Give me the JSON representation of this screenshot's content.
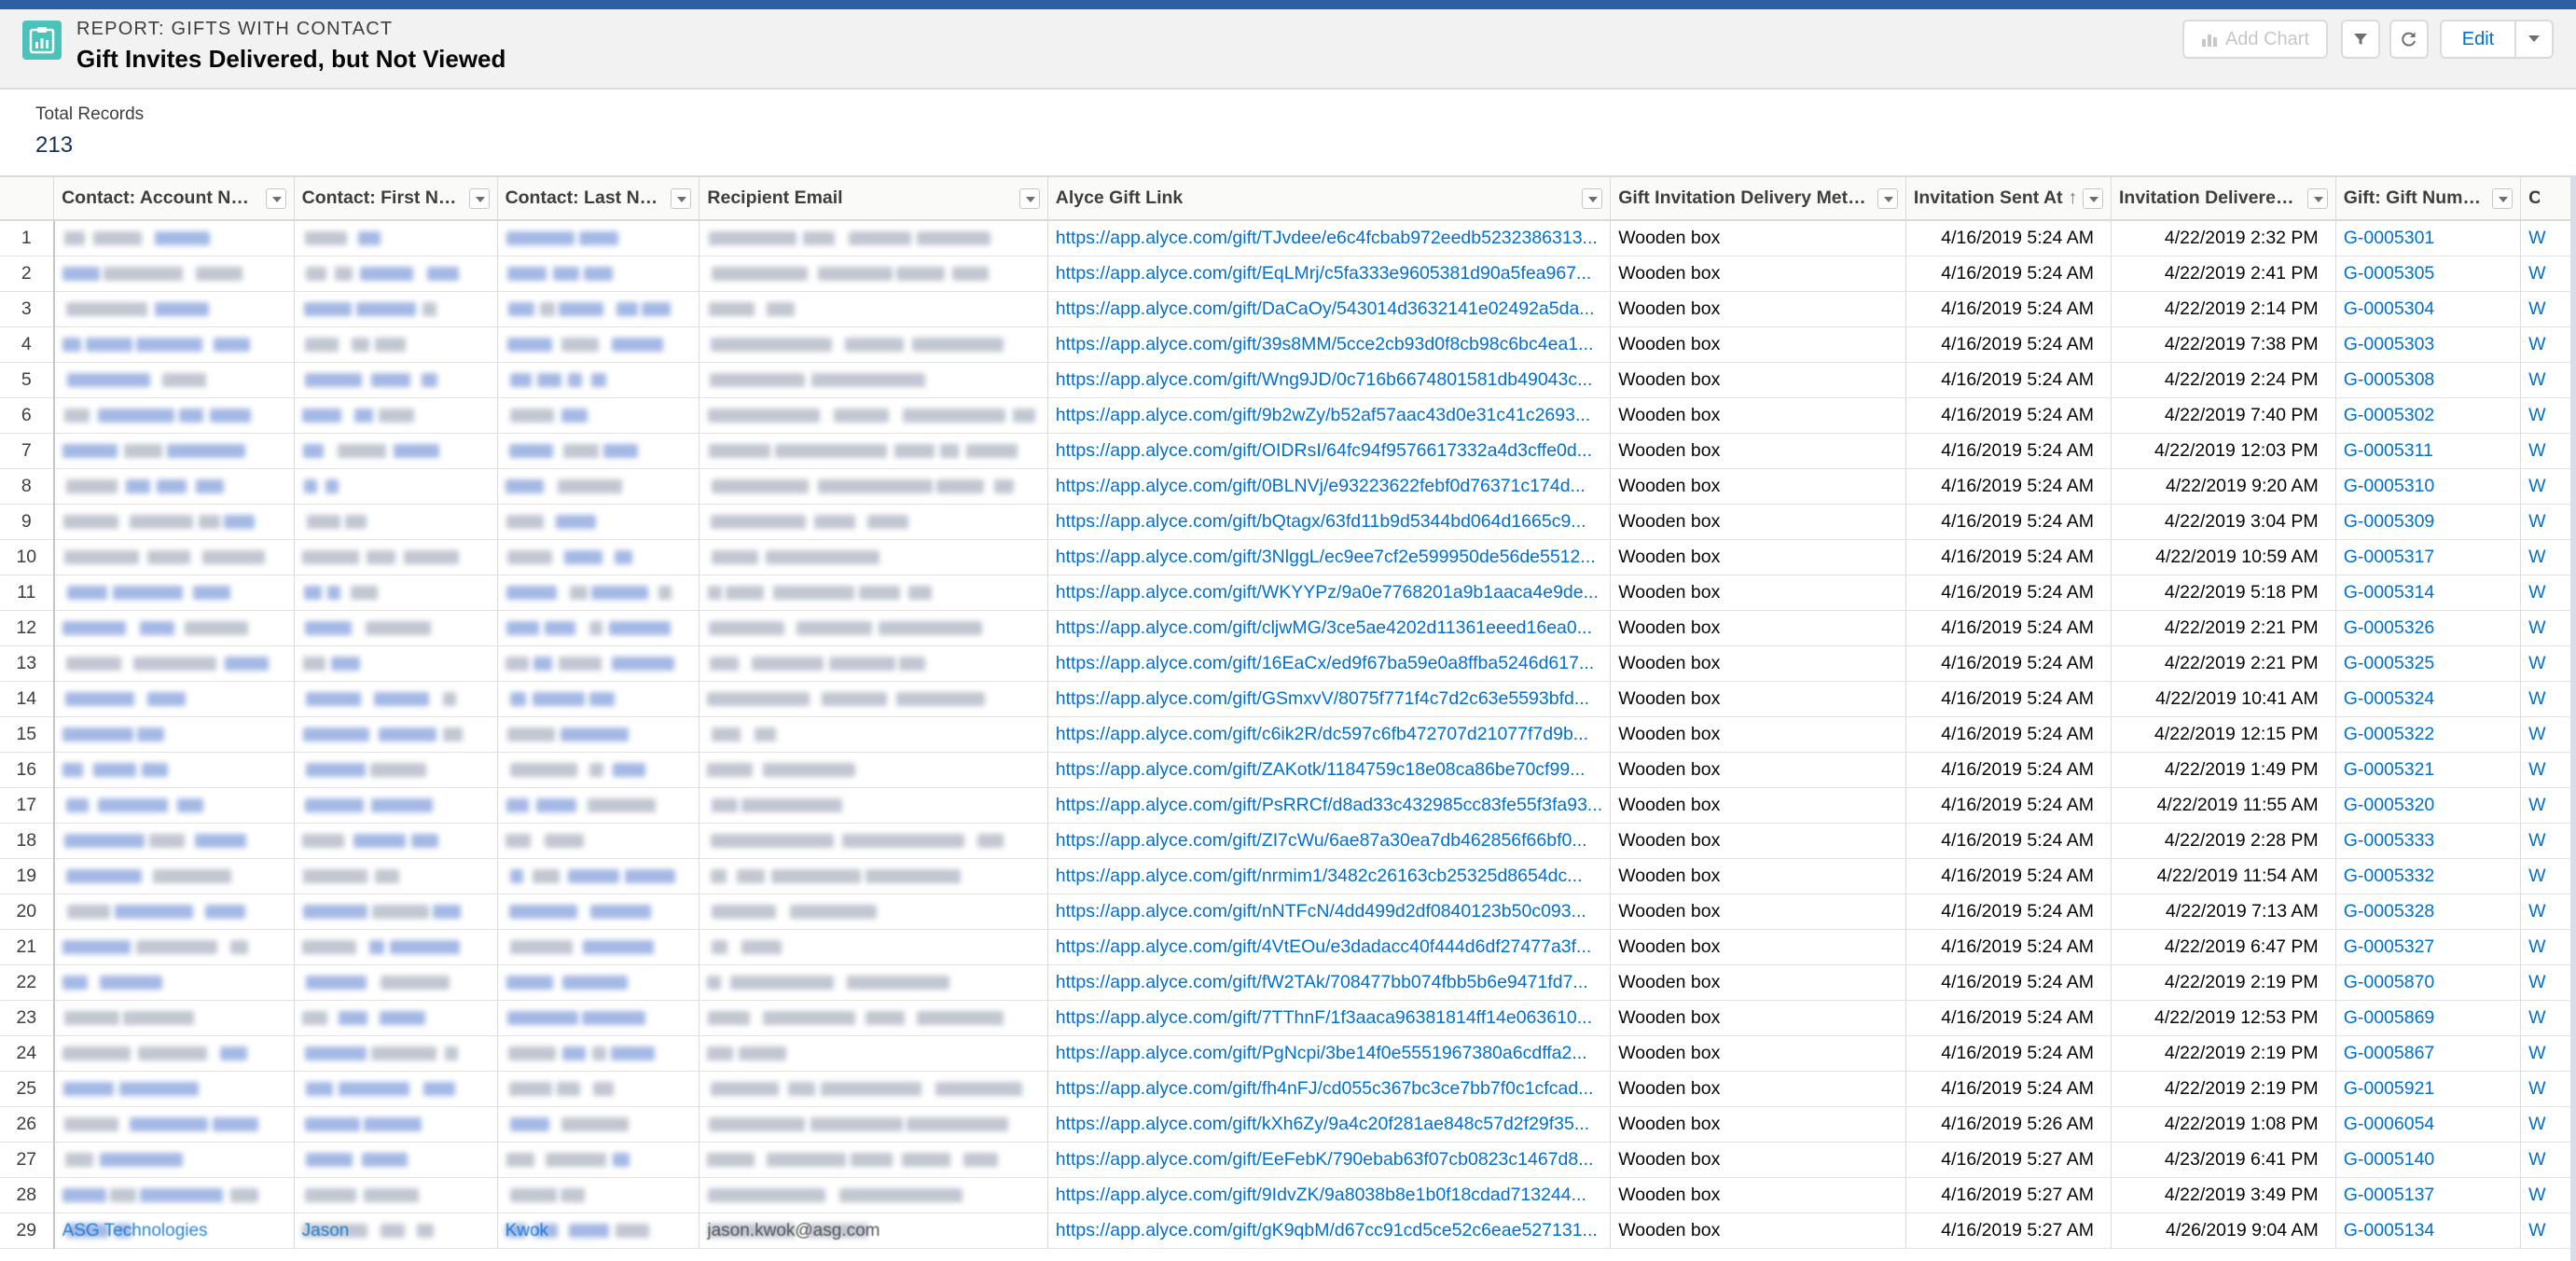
{
  "report": {
    "type_label": "REPORT: GIFTS WITH CONTACT",
    "title": "Gift Invites Delivered, but Not Viewed"
  },
  "toolbar": {
    "add_chart_label": "Add Chart",
    "edit_label": "Edit"
  },
  "summary": {
    "total_label": "Total Records",
    "total_value": "213"
  },
  "columns": [
    {
      "label": "Contact: Account Name"
    },
    {
      "label": "Contact: First Name"
    },
    {
      "label": "Contact: Last Name"
    },
    {
      "label": "Recipient Email"
    },
    {
      "label": "Alyce Gift Link"
    },
    {
      "label": "Gift Invitation Delivery Method"
    },
    {
      "label": "Invitation Sent At",
      "sort": "ascending"
    },
    {
      "label": "Invitation Delivered At"
    },
    {
      "label": "Gift: Gift Number"
    },
    {
      "label": "Ca"
    }
  ],
  "rows": [
    {
      "n": "1",
      "link": "https://app.alyce.com/gift/TJvdee/e6c4fcbab972eedb5232386313...",
      "method": "Wooden box",
      "sent": "4/16/2019 5:24 AM",
      "delivered": "4/22/2019 2:32 PM",
      "gift": "G-0005301",
      "extra": "W"
    },
    {
      "n": "2",
      "link": "https://app.alyce.com/gift/EqLMrj/c5fa333e9605381d90a5fea967...",
      "method": "Wooden box",
      "sent": "4/16/2019 5:24 AM",
      "delivered": "4/22/2019 2:41 PM",
      "gift": "G-0005305",
      "extra": "W"
    },
    {
      "n": "3",
      "link": "https://app.alyce.com/gift/DaCaOy/543014d3632141e02492a5da...",
      "method": "Wooden box",
      "sent": "4/16/2019 5:24 AM",
      "delivered": "4/22/2019 2:14 PM",
      "gift": "G-0005304",
      "extra": "W"
    },
    {
      "n": "4",
      "link": "https://app.alyce.com/gift/39s8MM/5cce2cb93d0f8cb98c6bc4ea1...",
      "method": "Wooden box",
      "sent": "4/16/2019 5:24 AM",
      "delivered": "4/22/2019 7:38 PM",
      "gift": "G-0005303",
      "extra": "W"
    },
    {
      "n": "5",
      "link": "https://app.alyce.com/gift/Wng9JD/0c716b6674801581db49043c...",
      "method": "Wooden box",
      "sent": "4/16/2019 5:24 AM",
      "delivered": "4/22/2019 2:24 PM",
      "gift": "G-0005308",
      "extra": "W"
    },
    {
      "n": "6",
      "link": "https://app.alyce.com/gift/9b2wZy/b52af57aac43d0e31c41c2693...",
      "method": "Wooden box",
      "sent": "4/16/2019 5:24 AM",
      "delivered": "4/22/2019 7:40 PM",
      "gift": "G-0005302",
      "extra": "W"
    },
    {
      "n": "7",
      "link": "https://app.alyce.com/gift/OIDRsI/64fc94f9576617332a4d3cffe0d...",
      "method": "Wooden box",
      "sent": "4/16/2019 5:24 AM",
      "delivered": "4/22/2019 12:03 PM",
      "gift": "G-0005311",
      "extra": "W"
    },
    {
      "n": "8",
      "link": "https://app.alyce.com/gift/0BLNVj/e93223622febf0d76371c174d...",
      "method": "Wooden box",
      "sent": "4/16/2019 5:24 AM",
      "delivered": "4/22/2019 9:20 AM",
      "gift": "G-0005310",
      "extra": "W"
    },
    {
      "n": "9",
      "link": "https://app.alyce.com/gift/bQtagx/63fd11b9d5344bd064d1665c9...",
      "method": "Wooden box",
      "sent": "4/16/2019 5:24 AM",
      "delivered": "4/22/2019 3:04 PM",
      "gift": "G-0005309",
      "extra": "W"
    },
    {
      "n": "10",
      "link": "https://app.alyce.com/gift/3NlggL/ec9ee7cf2e599950de56de5512...",
      "method": "Wooden box",
      "sent": "4/16/2019 5:24 AM",
      "delivered": "4/22/2019 10:59 AM",
      "gift": "G-0005317",
      "extra": "W"
    },
    {
      "n": "11",
      "link": "https://app.alyce.com/gift/WKYYPz/9a0e7768201a9b1aaca4e9de...",
      "method": "Wooden box",
      "sent": "4/16/2019 5:24 AM",
      "delivered": "4/22/2019 5:18 PM",
      "gift": "G-0005314",
      "extra": "W"
    },
    {
      "n": "12",
      "link": "https://app.alyce.com/gift/cljwMG/3ce5ae4202d11361eeed16ea0...",
      "method": "Wooden box",
      "sent": "4/16/2019 5:24 AM",
      "delivered": "4/22/2019 2:21 PM",
      "gift": "G-0005326",
      "extra": "W"
    },
    {
      "n": "13",
      "link": "https://app.alyce.com/gift/16EaCx/ed9f67ba59e0a8ffba5246d617...",
      "method": "Wooden box",
      "sent": "4/16/2019 5:24 AM",
      "delivered": "4/22/2019 2:21 PM",
      "gift": "G-0005325",
      "extra": "W"
    },
    {
      "n": "14",
      "link": "https://app.alyce.com/gift/GSmxvV/8075f771f4c7d2c63e5593bfd...",
      "method": "Wooden box",
      "sent": "4/16/2019 5:24 AM",
      "delivered": "4/22/2019 10:41 AM",
      "gift": "G-0005324",
      "extra": "W"
    },
    {
      "n": "15",
      "link": "https://app.alyce.com/gift/c6ik2R/dc597c6fb472707d21077f7d9b...",
      "method": "Wooden box",
      "sent": "4/16/2019 5:24 AM",
      "delivered": "4/22/2019 12:15 PM",
      "gift": "G-0005322",
      "extra": "W"
    },
    {
      "n": "16",
      "link": "https://app.alyce.com/gift/ZAKotk/1184759c18e08ca86be70cf99...",
      "method": "Wooden box",
      "sent": "4/16/2019 5:24 AM",
      "delivered": "4/22/2019 1:49 PM",
      "gift": "G-0005321",
      "extra": "W"
    },
    {
      "n": "17",
      "link": "https://app.alyce.com/gift/PsRRCf/d8ad33c432985cc83fe55f3fa93...",
      "method": "Wooden box",
      "sent": "4/16/2019 5:24 AM",
      "delivered": "4/22/2019 11:55 AM",
      "gift": "G-0005320",
      "extra": "W"
    },
    {
      "n": "18",
      "link": "https://app.alyce.com/gift/ZI7cWu/6ae87a30ea7db462856f66bf0...",
      "method": "Wooden box",
      "sent": "4/16/2019 5:24 AM",
      "delivered": "4/22/2019 2:28 PM",
      "gift": "G-0005333",
      "extra": "W"
    },
    {
      "n": "19",
      "link": "https://app.alyce.com/gift/nrmim1/3482c26163cb25325d8654dc...",
      "method": "Wooden box",
      "sent": "4/16/2019 5:24 AM",
      "delivered": "4/22/2019 11:54 AM",
      "gift": "G-0005332",
      "extra": "W"
    },
    {
      "n": "20",
      "link": "https://app.alyce.com/gift/nNTFcN/4dd499d2df0840123b50c093...",
      "method": "Wooden box",
      "sent": "4/16/2019 5:24 AM",
      "delivered": "4/22/2019 7:13 AM",
      "gift": "G-0005328",
      "extra": "W"
    },
    {
      "n": "21",
      "link": "https://app.alyce.com/gift/4VtEOu/e3dadacc40f444d6df27477a3f...",
      "method": "Wooden box",
      "sent": "4/16/2019 5:24 AM",
      "delivered": "4/22/2019 6:47 PM",
      "gift": "G-0005327",
      "extra": "W"
    },
    {
      "n": "22",
      "link": "https://app.alyce.com/gift/fW2TAk/708477bb074fbb5b6e9471fd7...",
      "method": "Wooden box",
      "sent": "4/16/2019 5:24 AM",
      "delivered": "4/22/2019 2:19 PM",
      "gift": "G-0005870",
      "extra": "W"
    },
    {
      "n": "23",
      "link": "https://app.alyce.com/gift/7TThnF/1f3aaca96381814ff14e063610...",
      "method": "Wooden box",
      "sent": "4/16/2019 5:24 AM",
      "delivered": "4/22/2019 12:53 PM",
      "gift": "G-0005869",
      "extra": "W"
    },
    {
      "n": "24",
      "link": "https://app.alyce.com/gift/PgNcpi/3be14f0e5551967380a6cdffa2...",
      "method": "Wooden box",
      "sent": "4/16/2019 5:24 AM",
      "delivered": "4/22/2019 2:19 PM",
      "gift": "G-0005867",
      "extra": "W"
    },
    {
      "n": "25",
      "link": "https://app.alyce.com/gift/fh4nFJ/cd055c367bc3ce7bb7f0c1cfcad...",
      "method": "Wooden box",
      "sent": "4/16/2019 5:24 AM",
      "delivered": "4/22/2019 2:19 PM",
      "gift": "G-0005921",
      "extra": "W"
    },
    {
      "n": "26",
      "link": "https://app.alyce.com/gift/kXh6Zy/9a4c20f281ae848c57d2f29f35...",
      "method": "Wooden box",
      "sent": "4/16/2019 5:26 AM",
      "delivered": "4/22/2019 1:08 PM",
      "gift": "G-0006054",
      "extra": "W"
    },
    {
      "n": "27",
      "link": "https://app.alyce.com/gift/EeFebK/790ebab63f07cb0823c1467d8...",
      "method": "Wooden box",
      "sent": "4/16/2019 5:27 AM",
      "delivered": "4/23/2019 6:41 PM",
      "gift": "G-0005140",
      "extra": "W"
    },
    {
      "n": "28",
      "link": "https://app.alyce.com/gift/9IdvZK/9a8038b8e1b0f18cdad713244...",
      "method": "Wooden box",
      "sent": "4/16/2019 5:27 AM",
      "delivered": "4/22/2019 3:49 PM",
      "gift": "G-0005137",
      "extra": "W"
    },
    {
      "n": "29",
      "link": "https://app.alyce.com/gift/gK9qbM/d67cc91cd5ce52c6eae527131...",
      "method": "Wooden box",
      "sent": "4/16/2019 5:27 AM",
      "delivered": "4/26/2019 9:04 AM",
      "gift": "G-0005134",
      "extra": "W",
      "account": "ASG Technologies",
      "first": "Jason",
      "last": "Kwok",
      "email": "jason.kwok@asg.com"
    }
  ],
  "colors": {
    "accent_link": "#0070d2",
    "report_icon": "#4bc3ba",
    "header_bg": "#f3f2f2",
    "top_strip": "#2d5fa3"
  },
  "icons": {
    "report": "report-clipboard-icon",
    "filter": "filter-icon",
    "refresh": "refresh-icon",
    "dropdown": "chevron-down-icon",
    "add_chart": "chart-icon"
  }
}
